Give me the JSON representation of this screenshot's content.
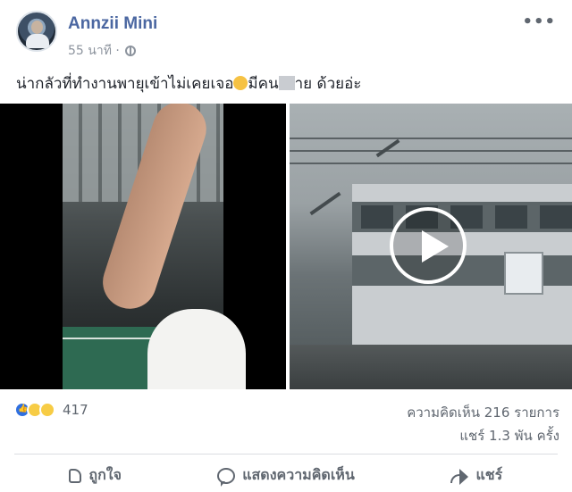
{
  "post": {
    "author": "Annzii Mini",
    "time": "55 นาที ·",
    "privacy_icon": "globe-icon",
    "menu_icon": "more-options-icon",
    "more_glyph": "•••",
    "caption_part1": "น่ากลัวที่ทำงานพายุเข้าไม่เคยเจอ",
    "caption_part2": "มีคน",
    "caption_part3": "าย ด้วยอ่ะ"
  },
  "stats": {
    "reaction_icons": [
      "like-icon",
      "wow-icon",
      "sad-icon"
    ],
    "reaction_count": "417",
    "comments": "ความคิดเห็น 216 รายการ",
    "shares": "แชร์ 1.3 พัน ครั้ง"
  },
  "actions": {
    "like": "ถูกใจ",
    "comment": "แสดงความคิดเห็น",
    "share": "แชร์"
  },
  "colors": {
    "author": "#4b67a1",
    "meta": "#8d949e",
    "action": "#606770",
    "like_blue": "#2f6fe0"
  }
}
